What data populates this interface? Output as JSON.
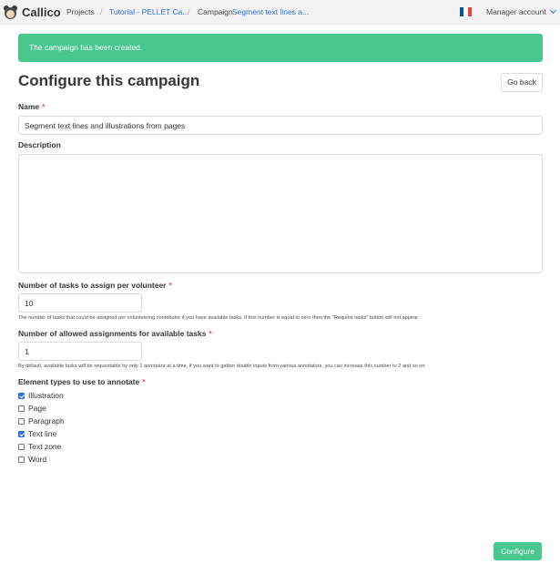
{
  "navbar": {
    "brand": "Callico",
    "projects_link": "Projects",
    "separator": "/",
    "project_crumb": "Tutorial - PELLET Ca...",
    "campaign_prefix": "Campaign",
    "campaign_crumb": "Segment text lines a...",
    "language_flag": "french-flag",
    "flag_colors": [
      "#0055a4",
      "#ffffff",
      "#ef4135"
    ],
    "account": "Manager account"
  },
  "notification": "The campaign has been created.",
  "page": {
    "title": "Configure this campaign",
    "go_back": "Go back"
  },
  "form": {
    "name_label": "Name",
    "required_mark": "*",
    "name_value": "Segment text lines and illustrations from pages",
    "description_label": "Description",
    "description_value": "",
    "tasks_label": "Number of tasks to assign per volunteer",
    "tasks_value": "10",
    "tasks_help": "The number of tasks that could be assigned per volunteering contributor if you have available tasks. If this number is equal to zero then the \"Request tasks\" button will not appear.",
    "assignments_label": "Number of allowed assignments for available tasks",
    "assignments_value": "1",
    "assignments_help": "By default, available tasks will be requestable by only 1 annotator at a time, if you want to gather double inputs from various annotators, you can increase this number to 2 and so on",
    "element_types_label": "Element types to use to annotate",
    "element_types": [
      {
        "label": "Illustration",
        "checked": true
      },
      {
        "label": "Page",
        "checked": false
      },
      {
        "label": "Paragraph",
        "checked": false
      },
      {
        "label": "Text line",
        "checked": true
      },
      {
        "label": "Text zone",
        "checked": false
      },
      {
        "label": "Word",
        "checked": false
      }
    ],
    "submit": "Configure"
  },
  "colors": {
    "accent_green": "#48c78e",
    "link_blue": "#3273dc",
    "required_red": "#f14668",
    "checkbox_blue": "#2f6fd9"
  }
}
